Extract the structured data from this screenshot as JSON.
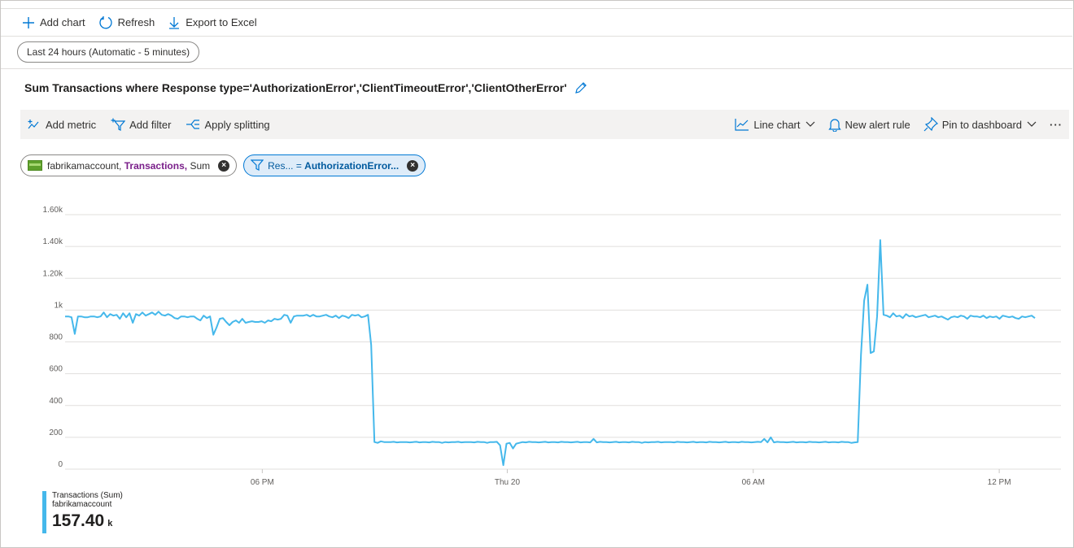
{
  "toolbar": {
    "add_chart": "Add chart",
    "refresh": "Refresh",
    "export": "Export to Excel"
  },
  "time_range": "Last 24 hours (Automatic - 5 minutes)",
  "chart_title": "Sum Transactions where Response type='AuthorizationError','ClientTimeoutError','ClientOtherError'",
  "commands": {
    "add_metric": "Add metric",
    "add_filter": "Add filter",
    "apply_splitting": "Apply splitting",
    "line_chart": "Line chart",
    "new_alert_rule": "New alert rule",
    "pin_to_dashboard": "Pin to dashboard",
    "more": "···"
  },
  "metric_pill": {
    "account": "fabrikamaccount,",
    "metric": "Transactions,",
    "aggregation": "Sum"
  },
  "filter_pill": {
    "key": "Res... =",
    "value": "AuthorizationError..."
  },
  "legend": {
    "name": "Transactions (Sum)",
    "resource": "fabrikamaccount",
    "value": "157.40",
    "unit": "k"
  },
  "colors": {
    "series": "#45b8eb",
    "accent": "#0078d4",
    "grid": "#e1dfdd"
  },
  "chart_data": {
    "type": "line",
    "x_ticks": [
      "06 PM",
      "Thu 20",
      "06 AM",
      "12 PM"
    ],
    "y_ticks": [
      "1.60k",
      "1.40k",
      "1.20k",
      "1k",
      "800",
      "600",
      "400",
      "200",
      "0"
    ],
    "ylim": [
      0,
      1600
    ],
    "grid": true,
    "series": [
      {
        "name": "Transactions (Sum)",
        "values": [
          960,
          960,
          955,
          850,
          960,
          960,
          955,
          955,
          960,
          960,
          955,
          960,
          985,
          955,
          975,
          965,
          970,
          945,
          980,
          955,
          980,
          920,
          975,
          965,
          985,
          965,
          975,
          985,
          970,
          990,
          970,
          965,
          975,
          965,
          950,
          945,
          960,
          960,
          955,
          960,
          960,
          945,
          935,
          965,
          950,
          960,
          845,
          890,
          945,
          950,
          925,
          905,
          925,
          935,
          920,
          945,
          920,
          925,
          930,
          925,
          925,
          930,
          920,
          935,
          930,
          945,
          940,
          945,
          970,
          965,
          920,
          960,
          965,
          965,
          965,
          970,
          960,
          970,
          960,
          960,
          965,
          970,
          960,
          955,
          965,
          950,
          965,
          960,
          950,
          970,
          965,
          970,
          955,
          960,
          970,
          780,
          170,
          165,
          175,
          170,
          170,
          170,
          172,
          168,
          170,
          170,
          170,
          168,
          170,
          172,
          168,
          170,
          170,
          168,
          172,
          170,
          170,
          165,
          170,
          168,
          170,
          170,
          172,
          168,
          170,
          170,
          170,
          168,
          172,
          170,
          170,
          165,
          170,
          170,
          172,
          150,
          25,
          160,
          165,
          130,
          160,
          165,
          170,
          168,
          172,
          170,
          170,
          168,
          170,
          172,
          168,
          170,
          170,
          168,
          172,
          170,
          170,
          168,
          170,
          172,
          168,
          170,
          170,
          168,
          190,
          168,
          172,
          170,
          170,
          168,
          170,
          172,
          168,
          170,
          170,
          168,
          172,
          170,
          170,
          165,
          170,
          168,
          170,
          170,
          172,
          168,
          170,
          170,
          170,
          168,
          172,
          170,
          170,
          168,
          170,
          172,
          168,
          170,
          170,
          168,
          172,
          170,
          170,
          168,
          170,
          172,
          168,
          170,
          170,
          168,
          172,
          170,
          170,
          168,
          170,
          172,
          170,
          190,
          168,
          200,
          168,
          172,
          170,
          170,
          168,
          170,
          172,
          168,
          170,
          170,
          168,
          172,
          170,
          170,
          168,
          170,
          172,
          168,
          170,
          170,
          168,
          172,
          170,
          170,
          165,
          168,
          170,
          720,
          1060,
          1160,
          730,
          740,
          960,
          1440,
          970,
          965,
          955,
          980,
          960,
          965,
          950,
          975,
          960,
          965,
          955,
          960,
          965,
          970,
          955,
          960,
          965,
          955,
          960,
          950,
          940,
          955,
          960,
          955,
          965,
          960,
          945,
          965,
          960,
          960,
          955,
          965,
          950,
          960,
          955,
          960,
          945,
          965,
          960,
          955,
          960,
          950,
          945,
          960,
          955,
          960,
          965,
          950
        ]
      }
    ]
  }
}
